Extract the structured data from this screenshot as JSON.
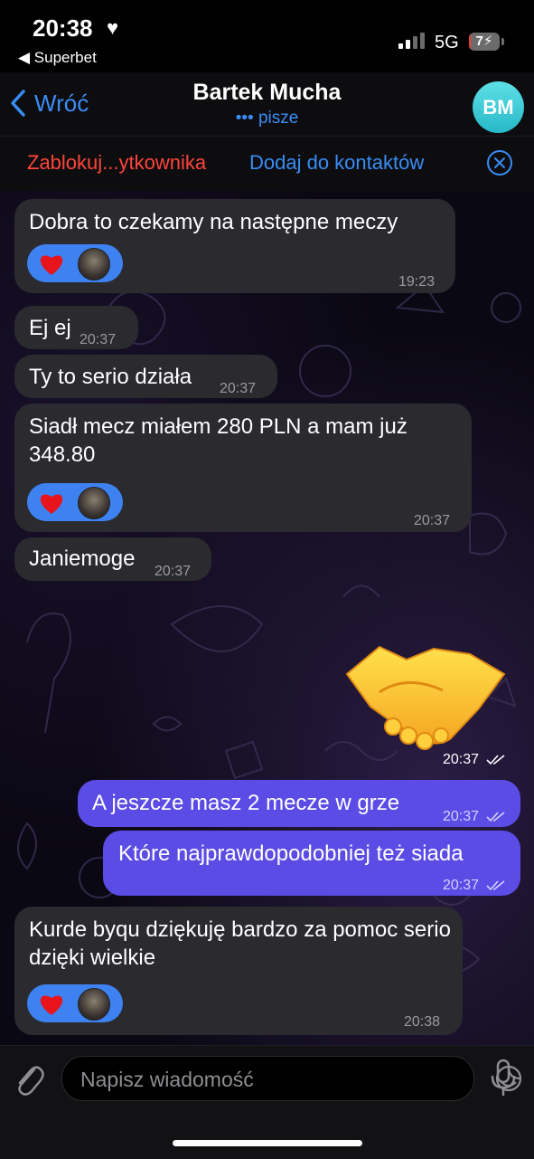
{
  "status_bar": {
    "time": "20:38",
    "back_app": "◀ Superbet",
    "network": "5G",
    "battery_level": "7",
    "battery_percent": 0.07
  },
  "header": {
    "back_label": "Wróć",
    "contact_name": "Bartek Mucha",
    "status": "••• pisze",
    "avatar_initials": "BM"
  },
  "action_bar": {
    "block_label": "Zablokuj...ytkownika",
    "add_label": "Dodaj do kontaktów"
  },
  "messages": [
    {
      "direction": "in",
      "text": "Dobra to czekamy na następne meczy",
      "time": "19:23",
      "reactions": [
        "heart",
        "avatar"
      ]
    },
    {
      "direction": "in",
      "text": "Ej ej",
      "time": "20:37"
    },
    {
      "direction": "in",
      "text": "Ty to serio działa",
      "time": "20:37"
    },
    {
      "direction": "in",
      "text": "Siadł mecz miałem 280 PLN a mam już 348.80",
      "time": "20:37",
      "reactions": [
        "heart",
        "avatar"
      ]
    },
    {
      "direction": "in",
      "text": "Janiemoge",
      "time": "20:37"
    },
    {
      "direction": "out",
      "type": "sticker",
      "sticker": "handshake-emoji",
      "time": "20:37",
      "read": true
    },
    {
      "direction": "out",
      "text": "A jeszcze masz 2 mecze w grze",
      "time": "20:37",
      "read": true
    },
    {
      "direction": "out",
      "text": "Które najprawdopodobniej też siada",
      "time": "20:37",
      "read": true
    },
    {
      "direction": "in",
      "text": "Kurde byqu dziękuję bardzo za pomoc serio dzięki wielkie",
      "time": "20:38",
      "reactions": [
        "heart",
        "avatar"
      ]
    }
  ],
  "input": {
    "placeholder": "Napisz wiadomość"
  },
  "colors": {
    "accent": "#3a8cf5",
    "outgoing_bubble": "#5b4ce6",
    "incoming_bubble": "#2a2a2f",
    "danger": "#ff453a",
    "avatar": "#2fc0cf"
  }
}
